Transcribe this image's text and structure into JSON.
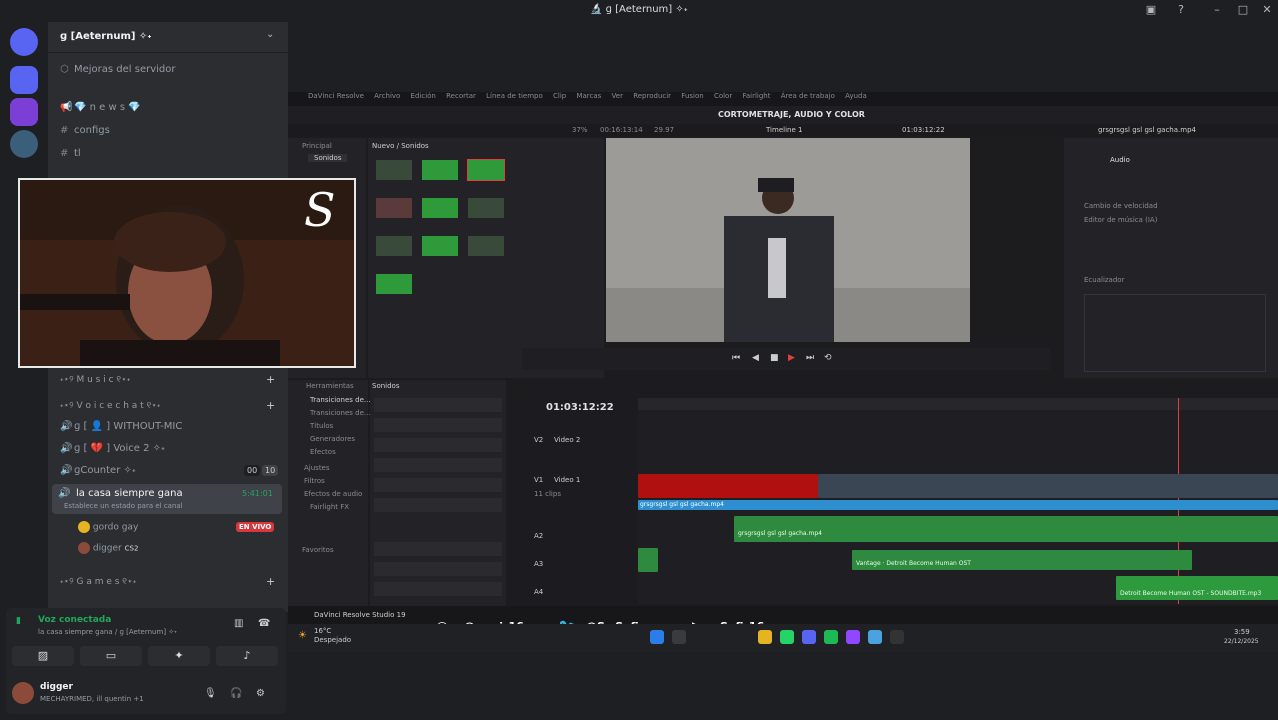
{
  "discord": {
    "window_title": "🔬 ɡ [Aeternum] ✧˖",
    "server_name": "ɡ [Aeternum] ✧˖",
    "server_boost": "Mejoras del servidor",
    "channels": [
      {
        "name": "💎 n e w s 💎",
        "type": "text"
      },
      {
        "name": "configs",
        "type": "text"
      },
      {
        "name": "tl",
        "type": "text"
      }
    ],
    "category_music": "˖⋆୨ M u s i c ୧⋆˖",
    "category_voice": "˖⋆୨ V o i c e  c h a t ୧⋆˖",
    "voice_channels": [
      {
        "name": "ɡ [ 👤 ] WITHOUT-MIC"
      },
      {
        "name": "ɡ [ 💔 ] Voice 2 ✧˖"
      },
      {
        "name": "ɡCounter ✧˖",
        "count_left": "00",
        "count_right": "10"
      },
      {
        "name": "la casa siempre gana",
        "timer": "5:41:01"
      }
    ],
    "set_status": "Establece un estado para el canal",
    "voice_users": [
      {
        "name": "gordo gay",
        "badge": "EN VIVO"
      },
      {
        "name": "digger",
        "tag": "CS2"
      }
    ],
    "category_games": "˖⋆୨ G a m e s ୧⋆˖",
    "voice_connected": {
      "status": "Voz conectada",
      "location": "la casa siempre gana / ɡ [Aeternum] ✧˖"
    },
    "user": {
      "name": "digger",
      "status": "MECHAYRIMED, ill quentin +1"
    }
  },
  "resolve": {
    "menu": [
      "DaVinci Resolve",
      "Archivo",
      "Edición",
      "Recortar",
      "Línea de tiempo",
      "Clip",
      "Marcas",
      "Ver",
      "Reproducir",
      "Fusion",
      "Color",
      "Fairlight",
      "Área de trabajo",
      "Ayuda"
    ],
    "project_title": "CORTOMETRAJE, AUDIO Y COLOR",
    "timeline_name": "Timeline 1",
    "timecode_top": "01:03:12:22",
    "zoom": "37%",
    "source_tc": "00:16:13:14",
    "fps": "29.97",
    "media_pool_title": "Nuevo / Sonidos",
    "inspector_clip": "grsgrsgsl gsl gsl gacha.mp4",
    "inspector_tab": "Audio",
    "inspector_rows": [
      "Cambio de velocidad",
      "Editor de música (IA)",
      "Ecualizador"
    ],
    "left_bin": [
      "Principal",
      "Sonidos"
    ],
    "effects_list": [
      "Herramientas",
      "Transiciones de...",
      "Transiciones de...",
      "Títulos",
      "Generadores",
      "Efectos",
      "Ajustes",
      "Filtros",
      "Efectos de audio",
      "Fairlight FX",
      "Favoritos"
    ],
    "effects_header": "Sonidos",
    "timeline_tc": "01:03:12:22",
    "tracks": [
      {
        "id": "V2",
        "name": "Video 2"
      },
      {
        "id": "V1",
        "name": "Video 1",
        "clips": "11 clips"
      },
      {
        "id": "A2",
        "name": ""
      },
      {
        "id": "A3",
        "name": ""
      },
      {
        "id": "A4",
        "name": ""
      }
    ],
    "clip_v1": "grsgrsgsl gsl gsl gacha.mp4",
    "clip_a2": "grsgrsgsl gsl gsl gacha.mp4",
    "clip_a3": "Vantage · Detroit Become Human OST",
    "clip_a4": "Detroit Become Human OST - SOUNDBITE.mp3",
    "app_name": "DaVinci Resolve Studio 19"
  },
  "overlay": {
    "instagram": "@ramir16_",
    "twitter": "@Sz Safir",
    "youtube": "Safir16"
  },
  "taskbar": {
    "weather": "16°C Despejado",
    "time": "3:59",
    "date": "22/12/2025"
  }
}
